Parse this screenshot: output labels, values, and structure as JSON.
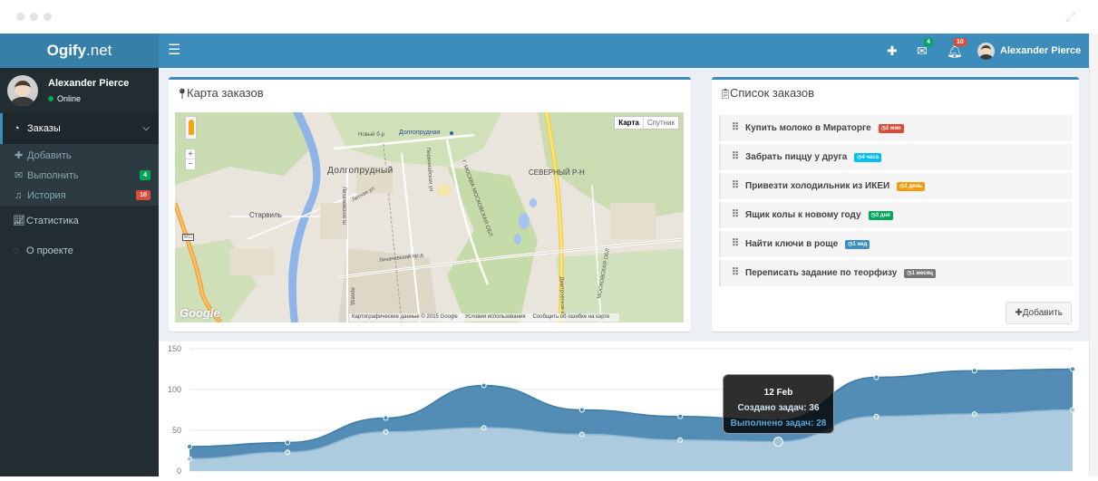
{
  "app": {
    "logo_main": "Ogify",
    "logo_suffix": ".net"
  },
  "header": {
    "menu_icon": "bars-icon",
    "mail_badge": "4",
    "bell_badge": "10",
    "user_name": "Alexander Pierce"
  },
  "sidebar": {
    "user_name": "Alexander Pierce",
    "status": "Online",
    "orders_label": "Заказы",
    "sub": [
      {
        "label": "Добавить",
        "badge": ""
      },
      {
        "label": "Выполнить",
        "badge": "4"
      },
      {
        "label": "История",
        "badge": "10"
      }
    ],
    "stats_label": "Статистика",
    "about_label": "О проекте"
  },
  "map_box": {
    "title": "Карта заказов",
    "toggle_map": "Карта",
    "toggle_sat": "Спутник",
    "labels": {
      "dolgoprudny": "Долгопрудный",
      "dolgoprudnaya": "Долгопрудная",
      "severny": "СЕВЕРНЫЙ Р-Н",
      "starvil": "Старвиль",
      "novy": "Новый б-р",
      "likhachevsky": "Лихачевский пр-д",
      "m11": "M11",
      "moscow_obl": "Г. МОСКВА МОСКОВСКАЯ ОБЛ",
      "dmitrovskoe": "Дмитровское ш",
      "letnyaya": "Летная ул",
      "pervomayskaya": "Первомайская ул",
      "likhachevskoe": "Лихачевское ш",
      "proezd": "проезд",
      "moskovskaya_obl2": "МОСКОВСКАЯ ОБЛ"
    },
    "footer": [
      "Картографические данные © 2015 Google",
      "Условия использования",
      "Сообщить об ошибке на карте"
    ],
    "google": "Google"
  },
  "orders_box": {
    "title": "Список заказов",
    "items": [
      {
        "text": "Купить молоко в Мираторге",
        "time": "2 мин",
        "color": "#dd4b39"
      },
      {
        "text": "Забрать пиццу у друга",
        "time": "4 часа",
        "color": "#00c0ef"
      },
      {
        "text": "Привезти холодильник из ИКЕИ",
        "time": "1 день",
        "color": "#f39c12"
      },
      {
        "text": "Ящик колы к новому году",
        "time": "3 дня",
        "color": "#00a65a"
      },
      {
        "text": "Найти ключи в роще",
        "time": "1 нед",
        "color": "#3c8dbc"
      },
      {
        "text": "Переписать задание по теорфизу",
        "time": "1 месяц",
        "color": "#777777"
      }
    ],
    "add_label": "Добавить"
  },
  "chart_data": {
    "type": "area",
    "y_ticks": [
      "150",
      "100",
      "50",
      "0"
    ],
    "ylim": [
      0,
      150
    ],
    "grid": true,
    "series": [
      {
        "name": "Создано задач",
        "color": "#4a86b0",
        "values": [
          30,
          35,
          65,
          105,
          75,
          67,
          62,
          115,
          123,
          125
        ]
      },
      {
        "name": "Выполнено задач",
        "color": "#b7d1e2",
        "values": [
          15,
          23,
          48,
          53,
          45,
          38,
          36,
          67,
          70,
          75
        ]
      }
    ],
    "tooltip": {
      "date": "12 Feb",
      "created": "Создано задач: 36",
      "done": "Выполнено задач: 28",
      "highlight_index": 6
    }
  }
}
